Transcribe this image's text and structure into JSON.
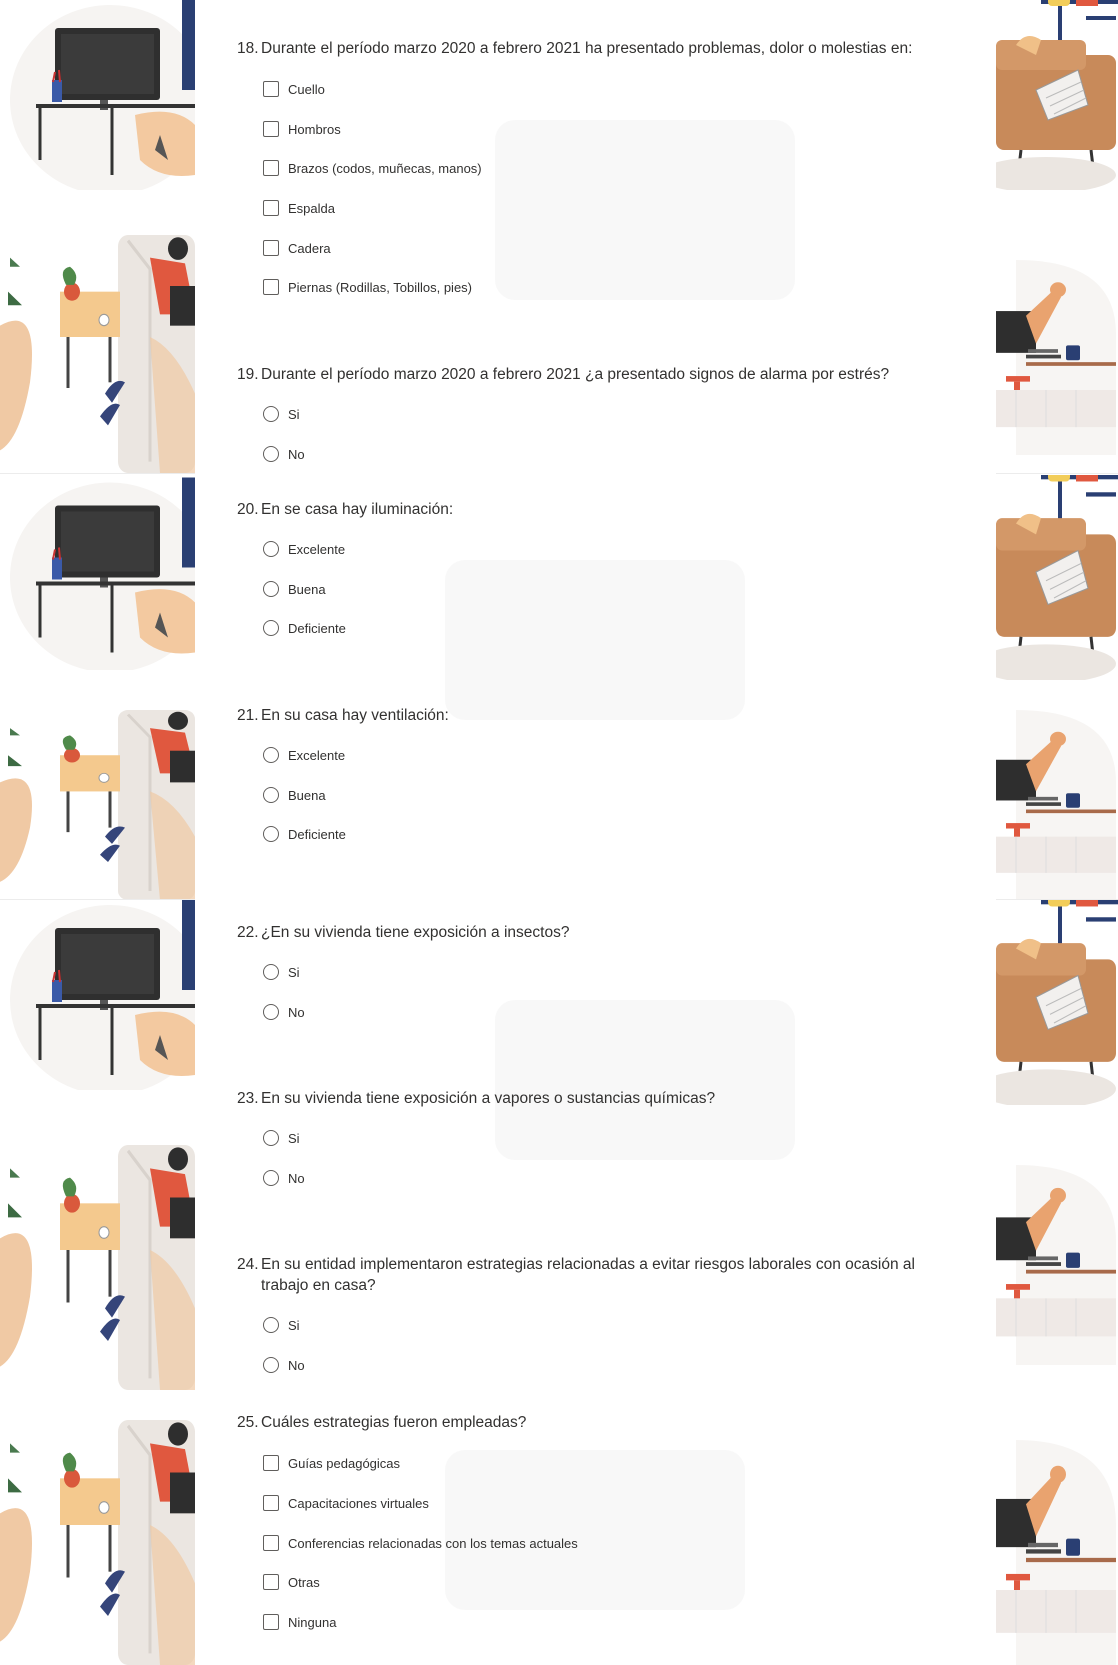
{
  "questions": [
    {
      "number": "18.",
      "text": "Durante el período marzo 2020 a febrero 2021 ha presentado problemas, dolor o molestias en:",
      "type": "checkbox",
      "options": [
        "Cuello",
        "Hombros",
        "Brazos (codos, muñecas, manos)",
        "Espalda",
        "Cadera",
        "Piernas (Rodillas, Tobillos, pies)"
      ]
    },
    {
      "number": "19.",
      "text": "Durante el período marzo 2020 a febrero 2021 ¿a presentado signos de alarma por estrés?",
      "type": "radio",
      "options": [
        "Si",
        "No"
      ]
    },
    {
      "number": "20.",
      "text": "En se casa hay iluminación:",
      "type": "radio",
      "options": [
        "Excelente",
        "Buena",
        "Deficiente"
      ]
    },
    {
      "number": "21.",
      "text": "En su casa hay ventilación:",
      "type": "radio",
      "options": [
        "Excelente",
        "Buena",
        "Deficiente"
      ]
    },
    {
      "number": "22.",
      "text": "¿En su vivienda tiene exposición a insectos?",
      "type": "radio",
      "options": [
        "Si",
        "No"
      ]
    },
    {
      "number": "23.",
      "text": "En su vivienda tiene exposición a vapores o sustancias químicas?",
      "type": "radio",
      "options": [
        "Si",
        "No"
      ]
    },
    {
      "number": "24.",
      "text": "En su entidad implementaron estrategias relacionadas a evitar riesgos laborales con ocasión al trabajo en casa?",
      "type": "radio",
      "options": [
        "Si",
        "No"
      ]
    },
    {
      "number": "25.",
      "text": "Cuáles estrategias fueron empleadas?",
      "type": "checkbox",
      "options": [
        "Guías pedagógicas",
        "Capacitaciones virtuales",
        "Conferencias relacionadas con los temas actuales",
        "Otras",
        "Ninguna"
      ]
    }
  ]
}
